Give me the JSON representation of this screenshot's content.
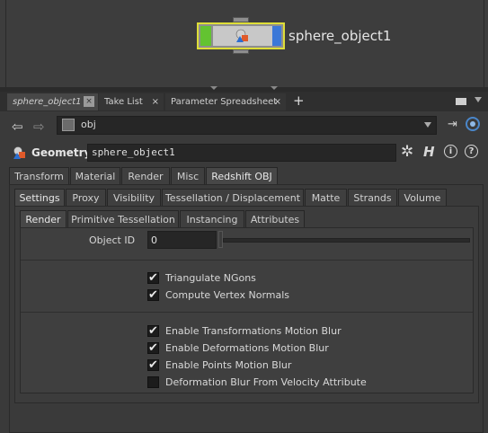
{
  "network": {
    "node_label": "sphere_object1"
  },
  "pane_tabs": [
    {
      "label": "sphere_object1"
    },
    {
      "label": "Take List",
      "close": "×"
    },
    {
      "label": "Parameter Spreadsheet",
      "close": "×"
    }
  ],
  "pane_tab_close_first": "×",
  "plus": "+",
  "path": {
    "back": "⇦",
    "forward": "⇨",
    "value": "obj",
    "pin": "⇥"
  },
  "header": {
    "type": "Geometry",
    "name": "sphere_object1",
    "gear": "✲",
    "help_h": "H",
    "info": "i",
    "question": "?"
  },
  "tabs_level1": [
    "Transform",
    "Material",
    "Render",
    "Misc",
    "Redshift OBJ"
  ],
  "tabs_level2": [
    "Settings",
    "Proxy",
    "Visibility",
    "Tessellation / Displacement",
    "Matte",
    "Strands",
    "Volume"
  ],
  "tabs_level3": [
    "Render",
    "Primitive Tessellation",
    "Instancing",
    "Attributes"
  ],
  "object_id": {
    "label": "Object ID",
    "value": "0"
  },
  "checkboxes": [
    {
      "label": "Triangulate NGons",
      "checked": true
    },
    {
      "label": "Compute Vertex Normals",
      "checked": true
    },
    {
      "label": "Enable Transformations Motion Blur",
      "checked": true
    },
    {
      "label": "Enable Deformations Motion Blur",
      "checked": true
    },
    {
      "label": "Enable Points Motion Blur",
      "checked": true
    },
    {
      "label": "Deformation Blur From Velocity Attribute",
      "checked": false
    }
  ],
  "checkmark": "✔",
  "colors": {
    "node_outline": "#dede37",
    "node_green": "#63c331",
    "node_blue": "#3b78d8",
    "link_blue": "#4a86c9"
  }
}
